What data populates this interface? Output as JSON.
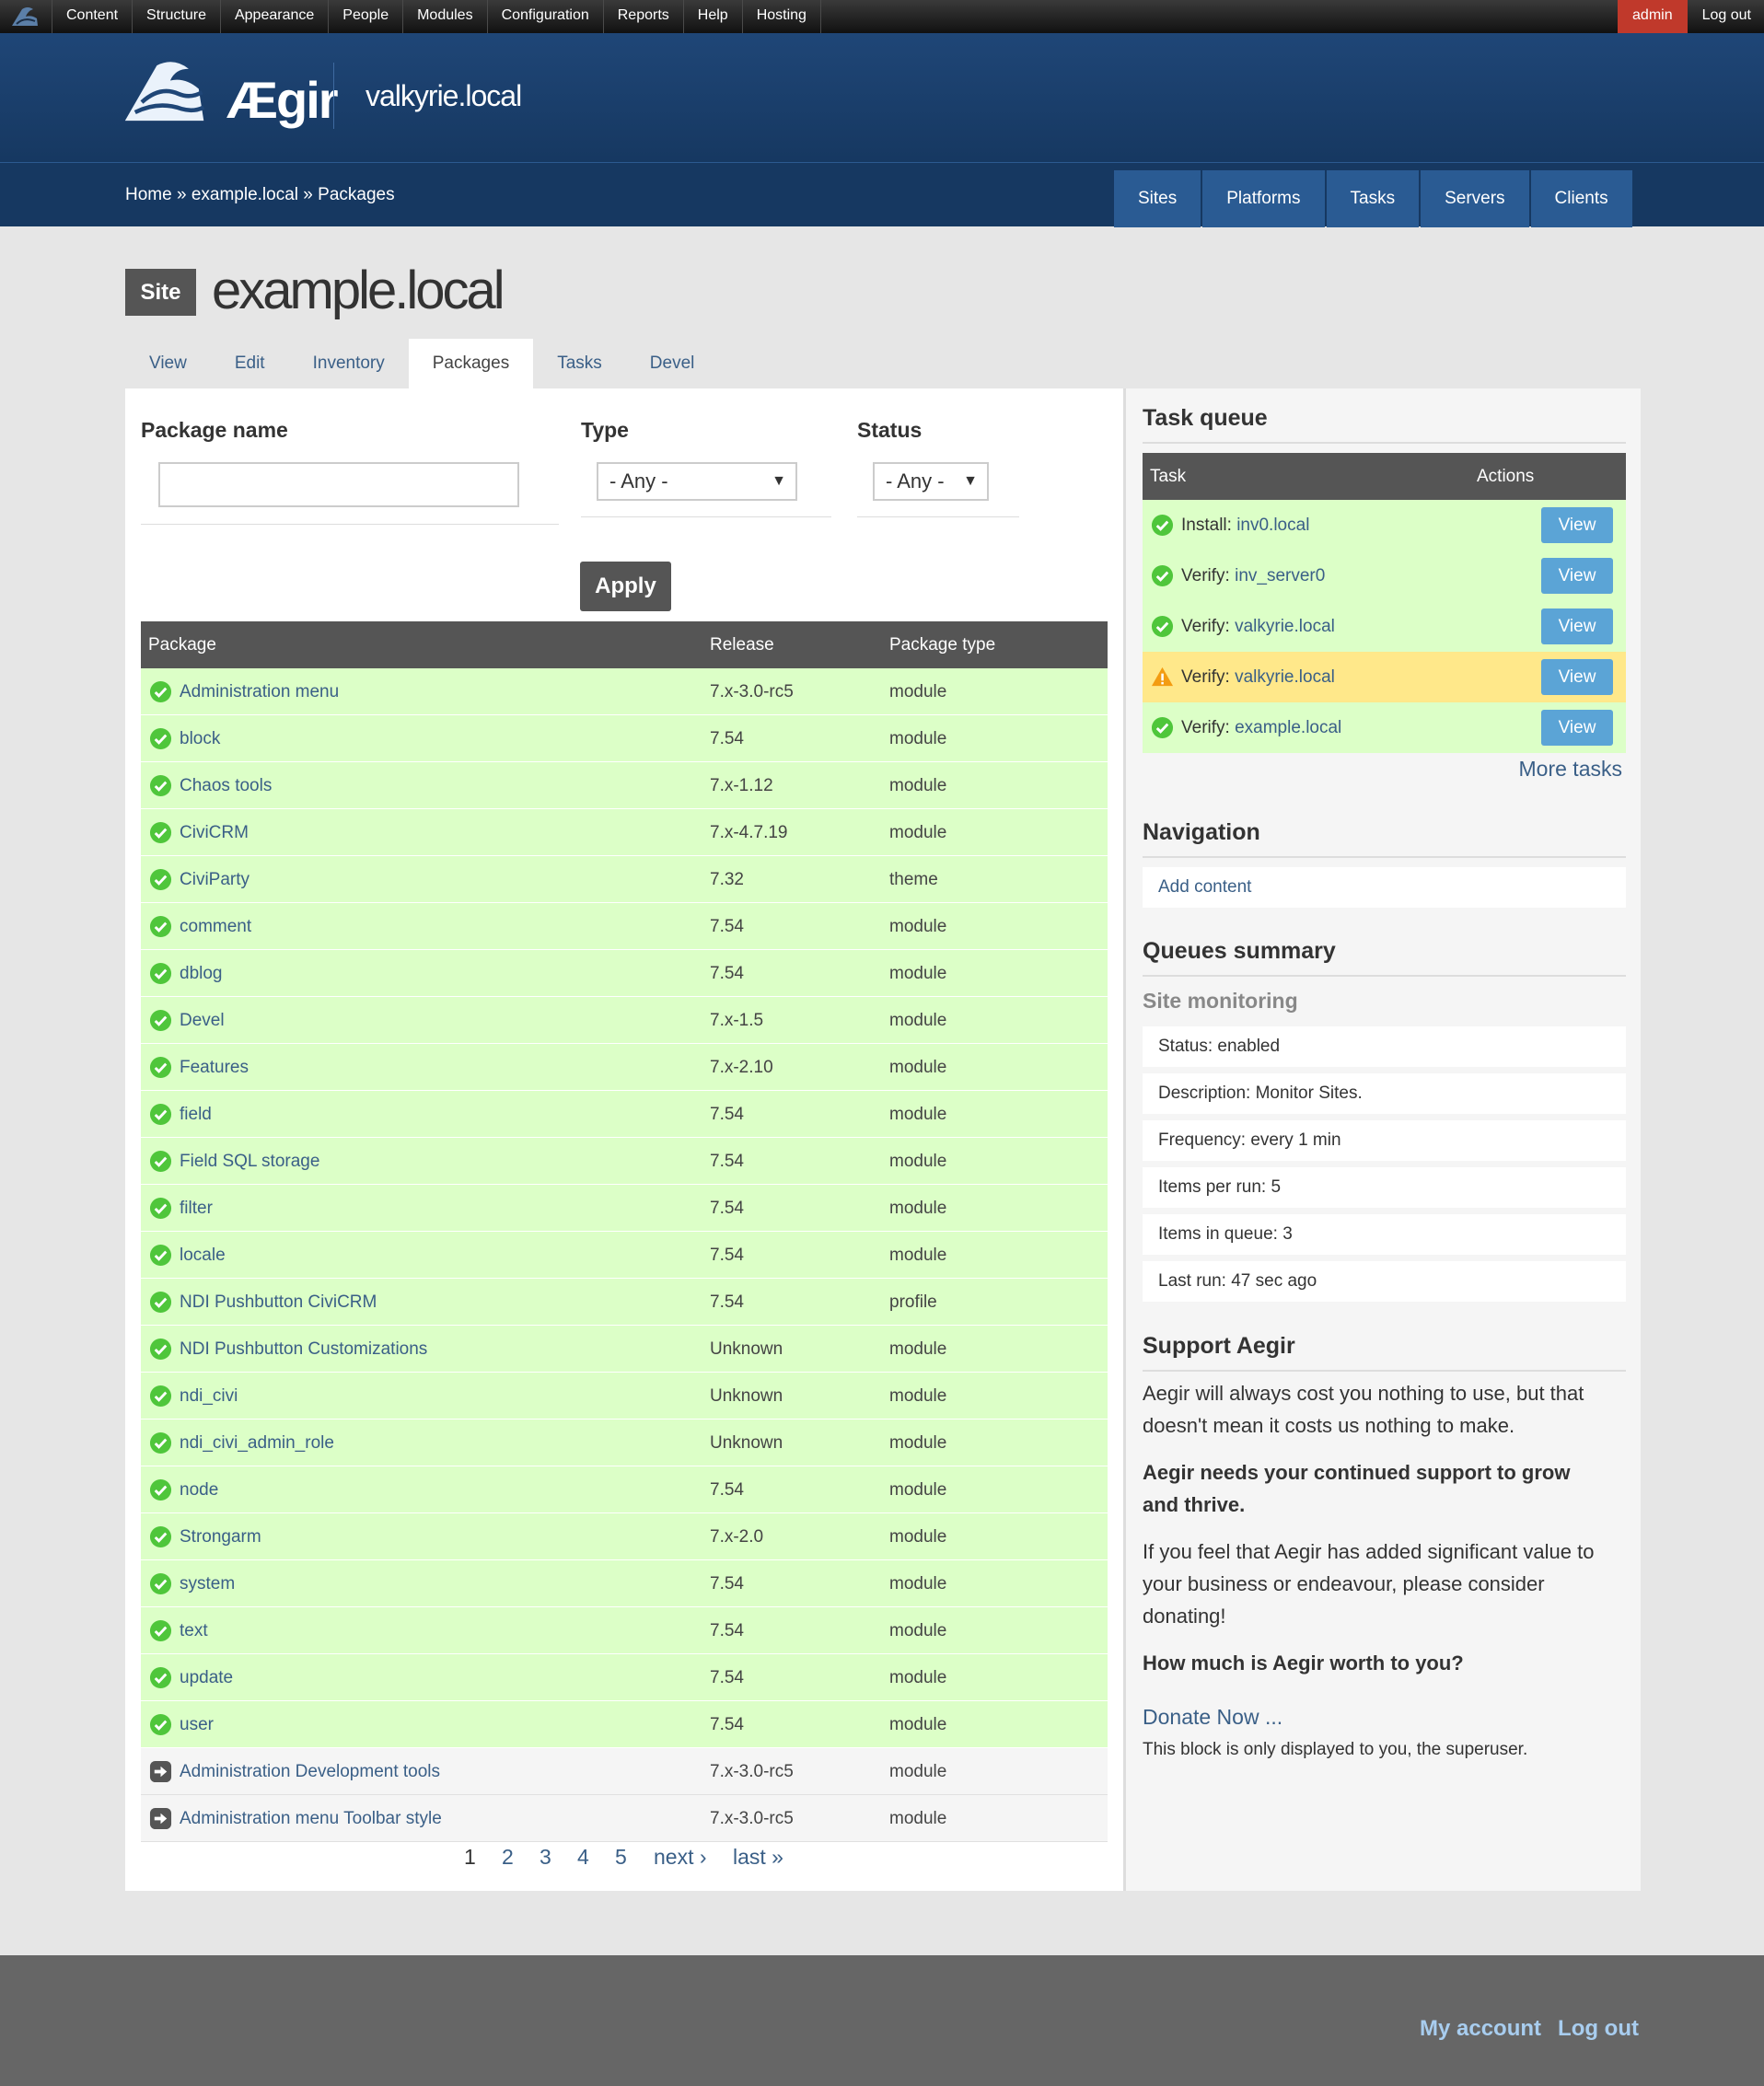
{
  "toolbar": {
    "menu": [
      "Content",
      "Structure",
      "Appearance",
      "People",
      "Modules",
      "Configuration",
      "Reports",
      "Help",
      "Hosting"
    ],
    "user": "admin",
    "logout": "Log out"
  },
  "header": {
    "logo_text": "Ægir",
    "site_name": "valkyrie.local"
  },
  "breadcrumb": {
    "home": "Home",
    "sep": "»",
    "site": "example.local",
    "current": "Packages"
  },
  "primary_tabs": [
    "Sites",
    "Platforms",
    "Tasks",
    "Servers",
    "Clients"
  ],
  "page": {
    "badge": "Site",
    "title": "example.local"
  },
  "secondary_tabs": [
    "View",
    "Edit",
    "Inventory",
    "Packages",
    "Tasks",
    "Devel"
  ],
  "filters": {
    "package_name_label": "Package name",
    "package_name_value": "",
    "type_label": "Type",
    "type_value": "- Any -",
    "status_label": "Status",
    "status_value": "- Any -",
    "apply": "Apply"
  },
  "table": {
    "headers": [
      "Package",
      "Release",
      "Package type"
    ],
    "rows": [
      {
        "name": "Administration menu",
        "release": "7.x-3.0-rc5",
        "type": "module",
        "status": "enabled"
      },
      {
        "name": "block",
        "release": "7.54",
        "type": "module",
        "status": "enabled"
      },
      {
        "name": "Chaos tools",
        "release": "7.x-1.12",
        "type": "module",
        "status": "enabled"
      },
      {
        "name": "CiviCRM",
        "release": "7.x-4.7.19",
        "type": "module",
        "status": "enabled"
      },
      {
        "name": "CiviParty",
        "release": "7.32",
        "type": "theme",
        "status": "enabled"
      },
      {
        "name": "comment",
        "release": "7.54",
        "type": "module",
        "status": "enabled"
      },
      {
        "name": "dblog",
        "release": "7.54",
        "type": "module",
        "status": "enabled"
      },
      {
        "name": "Devel",
        "release": "7.x-1.5",
        "type": "module",
        "status": "enabled"
      },
      {
        "name": "Features",
        "release": "7.x-2.10",
        "type": "module",
        "status": "enabled"
      },
      {
        "name": "field",
        "release": "7.54",
        "type": "module",
        "status": "enabled"
      },
      {
        "name": "Field SQL storage",
        "release": "7.54",
        "type": "module",
        "status": "enabled"
      },
      {
        "name": "filter",
        "release": "7.54",
        "type": "module",
        "status": "enabled"
      },
      {
        "name": "locale",
        "release": "7.54",
        "type": "module",
        "status": "enabled"
      },
      {
        "name": "NDI Pushbutton CiviCRM",
        "release": "7.54",
        "type": "profile",
        "status": "enabled"
      },
      {
        "name": "NDI Pushbutton Customizations",
        "release": "Unknown",
        "type": "module",
        "status": "enabled"
      },
      {
        "name": "ndi_civi",
        "release": "Unknown",
        "type": "module",
        "status": "enabled"
      },
      {
        "name": "ndi_civi_admin_role",
        "release": "Unknown",
        "type": "module",
        "status": "enabled"
      },
      {
        "name": "node",
        "release": "7.54",
        "type": "module",
        "status": "enabled"
      },
      {
        "name": "Strongarm",
        "release": "7.x-2.0",
        "type": "module",
        "status": "enabled"
      },
      {
        "name": "system",
        "release": "7.54",
        "type": "module",
        "status": "enabled"
      },
      {
        "name": "text",
        "release": "7.54",
        "type": "module",
        "status": "enabled"
      },
      {
        "name": "update",
        "release": "7.54",
        "type": "module",
        "status": "enabled"
      },
      {
        "name": "user",
        "release": "7.54",
        "type": "module",
        "status": "enabled"
      },
      {
        "name": "Administration Development tools",
        "release": "7.x-3.0-rc5",
        "type": "module",
        "status": "disabled"
      },
      {
        "name": "Administration menu Toolbar style",
        "release": "7.x-3.0-rc5",
        "type": "module",
        "status": "disabled"
      }
    ]
  },
  "pager": {
    "pages": [
      "1",
      "2",
      "3",
      "4",
      "5"
    ],
    "next": "next ›",
    "last": "last »"
  },
  "task_queue": {
    "title": "Task queue",
    "headers": [
      "Task",
      "Actions"
    ],
    "rows": [
      {
        "action": "Install:",
        "target": "inv0.local",
        "status": "success",
        "button": "View"
      },
      {
        "action": "Verify:",
        "target": "inv_server0",
        "status": "success",
        "button": "View"
      },
      {
        "action": "Verify:",
        "target": "valkyrie.local",
        "status": "success",
        "button": "View"
      },
      {
        "action": "Verify:",
        "target": "valkyrie.local",
        "status": "warning",
        "button": "View"
      },
      {
        "action": "Verify:",
        "target": "example.local",
        "status": "success",
        "button": "View"
      }
    ],
    "more": "More tasks"
  },
  "navigation": {
    "title": "Navigation",
    "items": [
      "Add content"
    ]
  },
  "queues_summary": {
    "title": "Queues summary",
    "subtitle": "Site monitoring",
    "items": [
      "Status: enabled",
      "Description: Monitor Sites.",
      "Frequency: every 1 min",
      "Items per run: 5",
      "Items in queue: 3",
      "Last run: 47 sec ago"
    ]
  },
  "support": {
    "title": "Support Aegir",
    "p1_line1": "Aegir will always cost you nothing to use, but that",
    "p1_line2": "doesn't mean it costs us nothing to make.",
    "p2_line1": "Aegir needs your continued support to grow",
    "p2_line2": "and thrive.",
    "p3_line1": "If you feel that Aegir has added significant value to",
    "p3_line2": "your business or endeavour, please consider",
    "p3_line3": "donating!",
    "p4": "How much is Aegir worth to you?",
    "donate": "Donate Now ...",
    "note": "This block is only displayed to you, the superuser."
  },
  "footer": {
    "my_account": "My account",
    "logout": "Log out"
  },
  "colors": {
    "header_blue": "#1f4677",
    "tab_blue": "#2a5b93",
    "row_ok": "#dcffc7",
    "row_warn": "#ffe88a",
    "button_blue": "#5ba4d6",
    "admin_red": "#c0392b"
  }
}
